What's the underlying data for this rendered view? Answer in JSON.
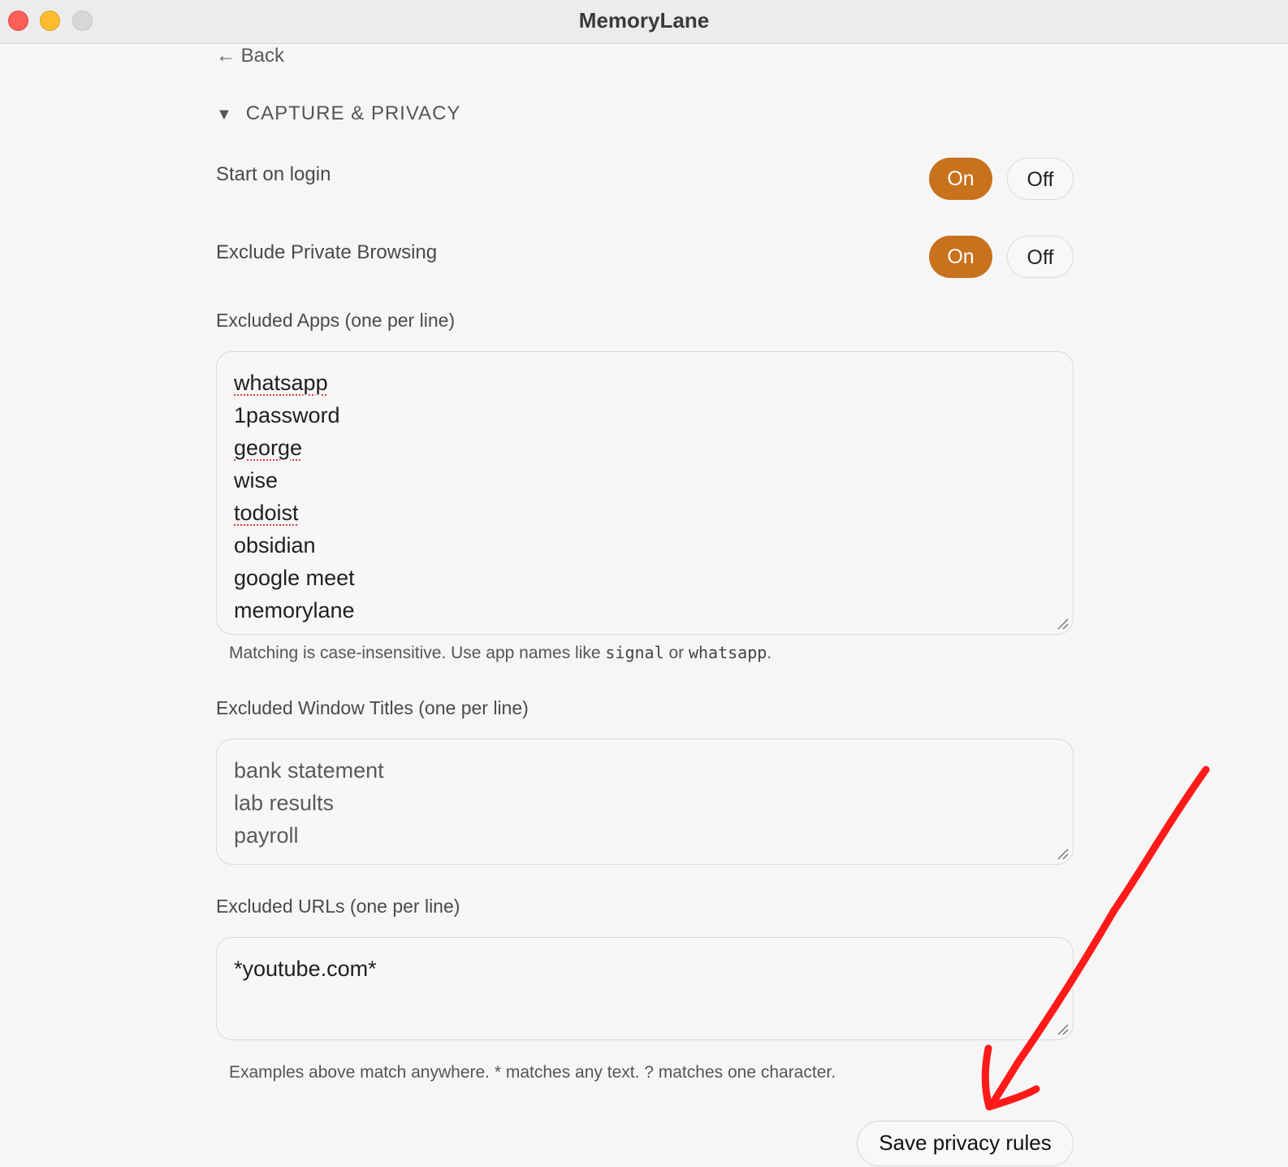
{
  "window": {
    "title": "MemoryLane",
    "controls": [
      "close",
      "minimize",
      "zoom"
    ]
  },
  "nav": {
    "back_label": "← Back"
  },
  "section": {
    "caret": "▼",
    "title": "CAPTURE & PRIVACY"
  },
  "settings": {
    "start_on_login": {
      "label": "Start on login",
      "on_label": "On",
      "off_label": "Off",
      "value": "On"
    },
    "exclude_private_browsing": {
      "label": "Exclude Private Browsing",
      "on_label": "On",
      "off_label": "Off",
      "value": "On"
    }
  },
  "excluded_apps": {
    "label": "Excluded Apps (one per line)",
    "lines": [
      "whatsapp",
      "1password",
      "george",
      "wise",
      "todoist",
      "obsidian",
      "google meet",
      "memorylane"
    ],
    "spellcheck_flagged": [
      "whatsapp",
      "george",
      "todoist"
    ],
    "hint_prefix": "Matching is case-insensitive. Use app names like ",
    "hint_code_1": "signal",
    "hint_mid": " or ",
    "hint_code_2": "whatsapp",
    "hint_suffix": "."
  },
  "excluded_window_titles": {
    "label": "Excluded Window Titles (one per line)",
    "lines": [
      "bank statement",
      "lab results",
      "payroll"
    ]
  },
  "excluded_urls": {
    "label": "Excluded URLs (one per line)",
    "lines": [
      "*youtube.com*"
    ],
    "hint": "Examples above match anywhere. * matches any text. ? matches one character."
  },
  "actions": {
    "save_label": "Save privacy rules"
  },
  "colors": {
    "accent": "#c8721d",
    "annotation_arrow": "#ff1a1a"
  }
}
